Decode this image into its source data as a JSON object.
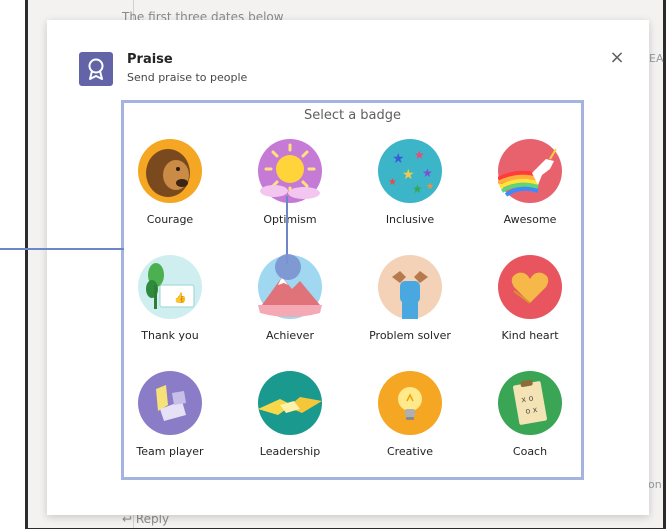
{
  "background": {
    "top_text": "The first three dates below",
    "reply_label": "Reply",
    "right_snippet_top": "EA",
    "right_snippet_bottom": "on"
  },
  "dialog": {
    "app_title": "Praise",
    "app_subtitle": "Send praise to people",
    "close_symbol": "×",
    "section_title": "Select a badge"
  },
  "badges": [
    {
      "label": "Courage",
      "icon": "lion-icon"
    },
    {
      "label": "Optimism",
      "icon": "sun-icon"
    },
    {
      "label": "Inclusive",
      "icon": "stars-icon"
    },
    {
      "label": "Awesome",
      "icon": "unicorn-icon"
    },
    {
      "label": "Thank you",
      "icon": "thank-you-card-icon"
    },
    {
      "label": "Achiever",
      "icon": "mountain-icon"
    },
    {
      "label": "Problem solver",
      "icon": "fist-icon"
    },
    {
      "label": "Kind heart",
      "icon": "heart-hands-icon"
    },
    {
      "label": "Team player",
      "icon": "team-hands-icon"
    },
    {
      "label": "Leadership",
      "icon": "handshake-icon"
    },
    {
      "label": "Creative",
      "icon": "lightbulb-icon"
    },
    {
      "label": "Coach",
      "icon": "clipboard-icon"
    }
  ],
  "colors": {
    "brand": "#6264a7",
    "highlight_border": "#a4b4df",
    "connector": "#6f86c6"
  }
}
